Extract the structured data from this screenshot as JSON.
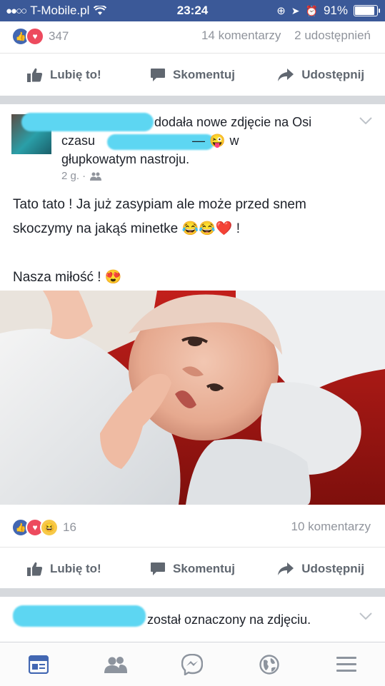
{
  "status_bar": {
    "signal_dots": "●●○○",
    "carrier": "T-Mobile.pl",
    "time": "23:24",
    "battery": "91%",
    "battery_level": 0.91
  },
  "post1": {
    "reaction_count": "347",
    "comments": "14 komentarzy",
    "shares": "2 udostępnień",
    "actions": {
      "like": "Lubię to!",
      "comment": "Skomentuj",
      "share": "Udostępnij"
    }
  },
  "post2": {
    "header_line1": "dodała nowe zdjęcie na Osi",
    "header_line2_a": "czasu",
    "header_line2_b": "—",
    "header_emoji": "😜",
    "header_line2_c": "w",
    "header_line3": "głupkowatym nastroju.",
    "time": "2 g. ·",
    "text_line1": "Tato tato ! Ja już zasypiam ale może przed snem",
    "text_line2": "skoczymy na jakąś minetke",
    "text_emojis": "😂😂❤️",
    "text_line2_end": " !",
    "text_line3": "Nasza miłość !",
    "text_emoji3": "😍",
    "reaction_count": "16",
    "comments": "10 komentarzy",
    "actions": {
      "like": "Lubię to!",
      "comment": "Skomentuj",
      "share": "Udostępnij"
    }
  },
  "post3": {
    "text": "został oznaczony na zdjęciu."
  },
  "colors": {
    "brand": "#3b5998",
    "like": "#4267b2",
    "love": "#ed4a5e",
    "redaction": "#5dd6f2"
  },
  "icons": {
    "nav": [
      "news-feed-icon",
      "friends-icon",
      "messenger-icon",
      "globe-notifications-icon",
      "menu-icon"
    ]
  }
}
